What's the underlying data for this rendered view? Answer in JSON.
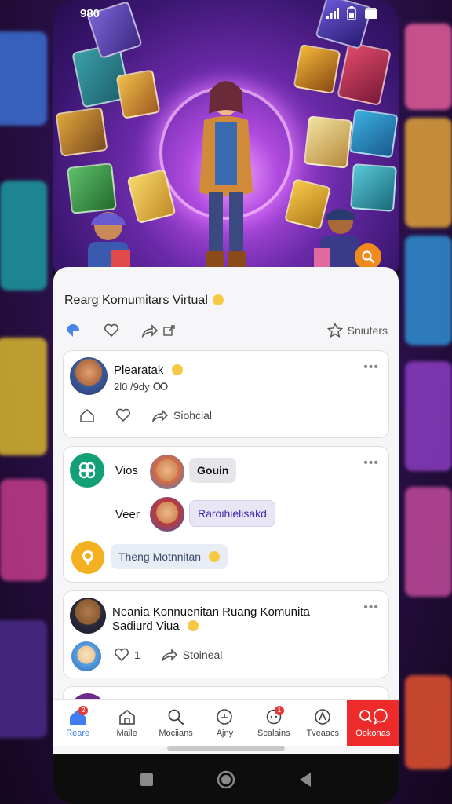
{
  "status_bar": {
    "time": "980"
  },
  "feed": {
    "title": "Rearg Komumitars Virtual"
  },
  "actions": {
    "share_label": "Sniuters"
  },
  "posts": [
    {
      "name": "Plearatak",
      "meta": "2l0 /9dy",
      "share_label": "Siohclal"
    },
    {
      "row1_label": "Vios",
      "row1_pill": "Gouin",
      "row2_label": "Veer",
      "row2_pill": "Raroihielisakd",
      "row3_pill": "Theng Motnnitan"
    },
    {
      "name_line1": "Neania Konnuenitan Ruang Komunita",
      "name_line2": "Sadiurd Viua",
      "like_count": "1",
      "share_label": "Stoineal"
    }
  ],
  "bottom_nav": [
    {
      "label": "Reare",
      "icon": "home-icon",
      "badge": "2"
    },
    {
      "label": "Maile",
      "icon": "house-outline-icon"
    },
    {
      "label": "Mociians",
      "icon": "search-icon"
    },
    {
      "label": "Ajny",
      "icon": "compass-icon"
    },
    {
      "label": "Scalains",
      "icon": "chat-bubble-icon",
      "badge": "1"
    },
    {
      "label": "Tveaacs",
      "icon": "explore-icon"
    },
    {
      "label": "Ookonas",
      "icon": "search-chat-icon"
    }
  ],
  "colors": {
    "accent": "#3f7df0",
    "hot": "#ee2b2b",
    "search_button": "#f08a1c"
  }
}
